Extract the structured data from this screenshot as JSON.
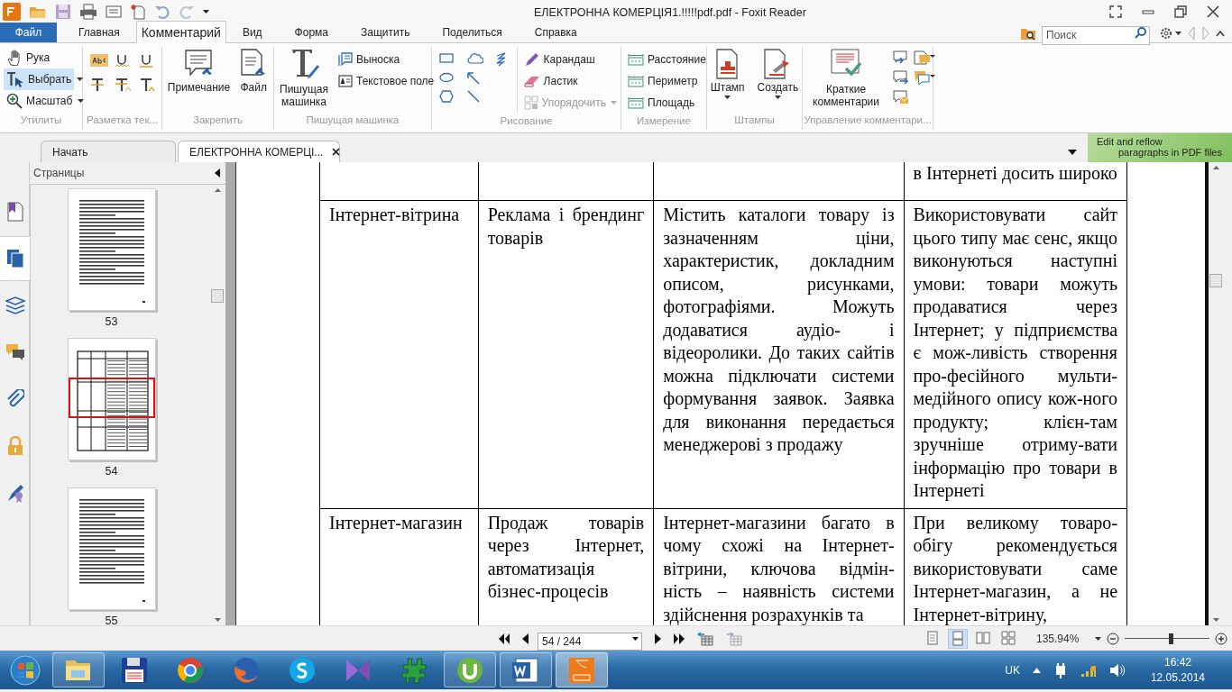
{
  "title_bar": {
    "title": "ЕЛЕКТРОННА КОМЕРЦІЯ1.!!!!!pdf.pdf - Foxit Reader"
  },
  "ribbon_tabs": [
    {
      "label": "Файл",
      "kind": "file",
      "selected": false
    },
    {
      "label": "Главная",
      "kind": "tab",
      "selected": false
    },
    {
      "label": "Комментарий",
      "kind": "tab",
      "selected": true
    },
    {
      "label": "Вид",
      "kind": "tab",
      "selected": false
    },
    {
      "label": "Форма",
      "kind": "tab",
      "selected": false
    },
    {
      "label": "Защитить",
      "kind": "tab",
      "selected": false
    },
    {
      "label": "Поделиться",
      "kind": "tab",
      "selected": false
    },
    {
      "label": "Справка",
      "kind": "tab",
      "selected": false
    }
  ],
  "search": {
    "placeholder": "Поиск"
  },
  "ribbon_groups": [
    {
      "label": "Утилиты",
      "tools": [
        {
          "label": "Рука",
          "selected": false
        },
        {
          "label": "Выбрать",
          "selected": true
        },
        {
          "label": "Масштаб",
          "selected": false
        }
      ]
    },
    {
      "label": "Разметка тек..."
    },
    {
      "label": "Закрепить",
      "tools": [
        {
          "label": "Примечание"
        },
        {
          "label": "Файл"
        }
      ]
    },
    {
      "label": "Пишущая машинка",
      "tools": [
        {
          "label": "Пишущая машинка"
        },
        {
          "label": "Выноска"
        },
        {
          "label": "Текстовое поле"
        }
      ]
    },
    {
      "label": "Рисование",
      "tools": [
        {
          "label": "Карандаш",
          "disabled": false
        },
        {
          "label": "Ластик",
          "disabled": false
        },
        {
          "label": "Упорядочить",
          "disabled": true
        }
      ]
    },
    {
      "label": "Измерение",
      "tools": [
        {
          "label": "Расстояние"
        },
        {
          "label": "Периметр"
        },
        {
          "label": "Площадь"
        }
      ]
    },
    {
      "label": "Штампы",
      "tools": [
        {
          "label": "Штамп"
        },
        {
          "label": "Создать"
        }
      ]
    },
    {
      "label": "Управление комментари...",
      "tools": [
        {
          "label": "Краткие комментарии"
        }
      ]
    }
  ],
  "doc_tabs": [
    {
      "label": "Начать",
      "selected": false
    },
    {
      "label": "ЕЛЕКТРОННА КОМЕРЦІ...",
      "selected": true
    }
  ],
  "promo": {
    "lines": [
      "Edit and reflow",
      "paragraphs in PDF files"
    ]
  },
  "side_tabs": [
    {
      "selected": false
    },
    {
      "selected": true
    },
    {
      "selected": false
    },
    {
      "selected": false
    },
    {
      "selected": false
    },
    {
      "selected": false
    },
    {
      "selected": false
    }
  ],
  "pages_panel": {
    "title": "Страницы",
    "thumbnails": [
      {
        "label": "53",
        "kind": "text",
        "viewport_marker": false
      },
      {
        "label": "54",
        "kind": "table",
        "viewport_marker": true
      },
      {
        "label": "55",
        "kind": "text",
        "viewport_marker": false
      }
    ]
  },
  "table": {
    "rows": [
      {
        "column_4": "в Інтернеті досить широко"
      },
      {
        "column_1": "Інтернет-вітрина",
        "column_2": "Реклама і брендинг товарів",
        "column_3": "Містить каталоги товару із зазначенням ціни, характеристик, докладним описом, рисунками, фотографіями. Можуть додаватися аудіо- і відеоролики. До таких сайтів можна підключати системи формування заявок. Заявка для виконання передається менеджерові з продажу",
        "column_4": "Використовувати сайт цього типу має сенс, якщо виконуються наступні умови: товари можуть продаватися через Інтернет; у підприємства є мож-ливість створення про-фесійного мульти-медійного опису кож-ного продукту; клієн-там зручніше отриму-вати інформацію про товари в Інтернеті"
      },
      {
        "column_1": "Інтернет-магазин",
        "column_2": "Продаж товарів через Інтернет, автоматизація бізнес-процесів",
        "column_3": "Інтернет-магазини багато в чому схожі на Інтернет-вітрини, ключова відмін-ність – наявність системи здійснення розрахунків та",
        "column_4": "При великому товаро-обігу рекомендується використовувати саме Інтернет-магазин, а не Інтернет-вітрину,"
      }
    ]
  },
  "status_bar": {
    "page": "54 / 244",
    "view_modes": [
      {
        "selected": false
      },
      {
        "selected": true
      },
      {
        "selected": false
      },
      {
        "selected": false
      }
    ],
    "zoom": "135.94%",
    "zoom_slider": {
      "level": 0.54
    }
  },
  "taskbar": {
    "apps": [
      {
        "running": true,
        "selected": false
      },
      {
        "running": false,
        "selected": false
      },
      {
        "running": false,
        "selected": false
      },
      {
        "running": false,
        "selected": false
      },
      {
        "running": false,
        "selected": false
      },
      {
        "running": false,
        "selected": false
      },
      {
        "running": false,
        "selected": false
      },
      {
        "running": true,
        "selected": false
      },
      {
        "running": true,
        "selected": false
      },
      {
        "running": true,
        "selected": true
      }
    ],
    "language": "UK",
    "time": "16:42",
    "date": "12.05.2014"
  }
}
